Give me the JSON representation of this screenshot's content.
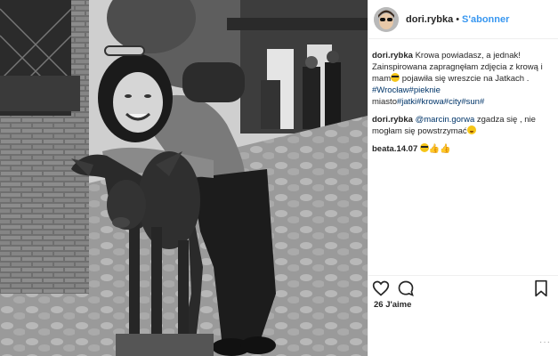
{
  "post": {
    "username": "dori.rybka",
    "follow_label": "S'abonner",
    "separator": "•"
  },
  "comments": [
    {
      "user": "dori.rybka",
      "segments": [
        {
          "text": "Krowa powiadasz, a jednak! Zainspirowana zapragnęłam zdjęcia z krową i mam",
          "kind": "text"
        },
        {
          "text": "sunglasses-emoji",
          "kind": "emoji"
        },
        {
          "text": " pojawiła się wreszcie na Jatkach . ",
          "kind": "text"
        },
        {
          "text": "#Wrocław",
          "kind": "tag"
        },
        {
          "text": "#pieknie",
          "kind": "tag"
        },
        {
          "text": " miasto",
          "kind": "text"
        },
        {
          "text": "#jatki",
          "kind": "tag"
        },
        {
          "text": "#krowa",
          "kind": "tag"
        },
        {
          "text": "#city",
          "kind": "tag"
        },
        {
          "text": "#sun",
          "kind": "tag"
        },
        {
          "text": "#",
          "kind": "tag"
        }
      ]
    },
    {
      "user": "dori.rybka",
      "mention": "@marcin.gorwa",
      "text": " zgadza się , nie mogłam się powstrzymać",
      "emoji": "sweat-smile-emoji"
    },
    {
      "user": "beata.14.07",
      "emojis": [
        "sunglasses-emoji",
        "thumbs-up-emoji",
        "thumbs-up-emoji"
      ]
    }
  ],
  "likes_text": "26 J'aime",
  "icons": {
    "like": "heart-icon",
    "comment": "comment-icon",
    "save": "bookmark-icon"
  },
  "colors": {
    "follow": "#3897f0",
    "hashtag": "#003569",
    "text": "#262626"
  }
}
